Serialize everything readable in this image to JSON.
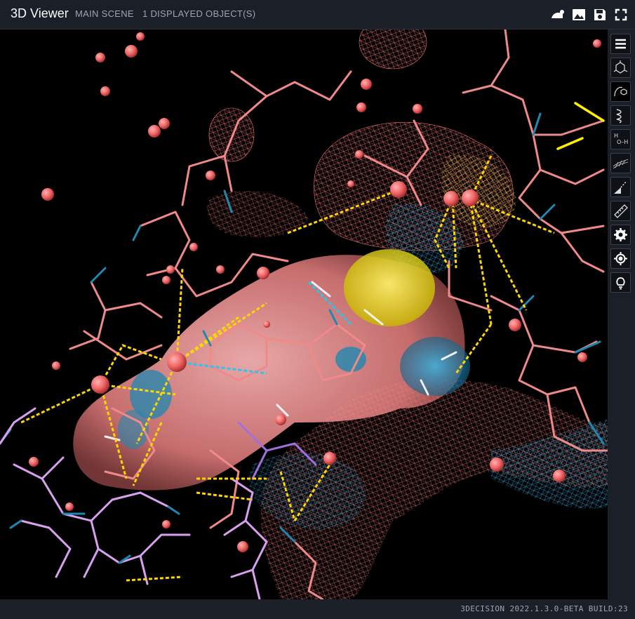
{
  "header": {
    "title": "3D Viewer",
    "scene": "MAIN SCENE",
    "objects": "1 DISPLAYED OBJECT(S)",
    "actions": [
      "surface-icon",
      "image-icon",
      "save-icon",
      "fullscreen-icon"
    ]
  },
  "toolbar": {
    "buttons": [
      "menu-icon",
      "small-molecule-icon",
      "ligand-icon",
      "ribbon-icon",
      "water-icon",
      "surface-mesh-icon",
      "interactions-icon",
      "measure-icon",
      "settings-icon",
      "target-icon",
      "lightbulb-icon"
    ]
  },
  "footer": {
    "build": "3DECISION 2022.1.3.0-BETA BUILD:23"
  },
  "colors": {
    "chrome": "#1b2028",
    "carbon": "#f08080",
    "nitrogen": "#1e88b0",
    "sulfur": "#ffee00",
    "ligand": "#d9a0f0",
    "hbond": "#ffd600"
  }
}
